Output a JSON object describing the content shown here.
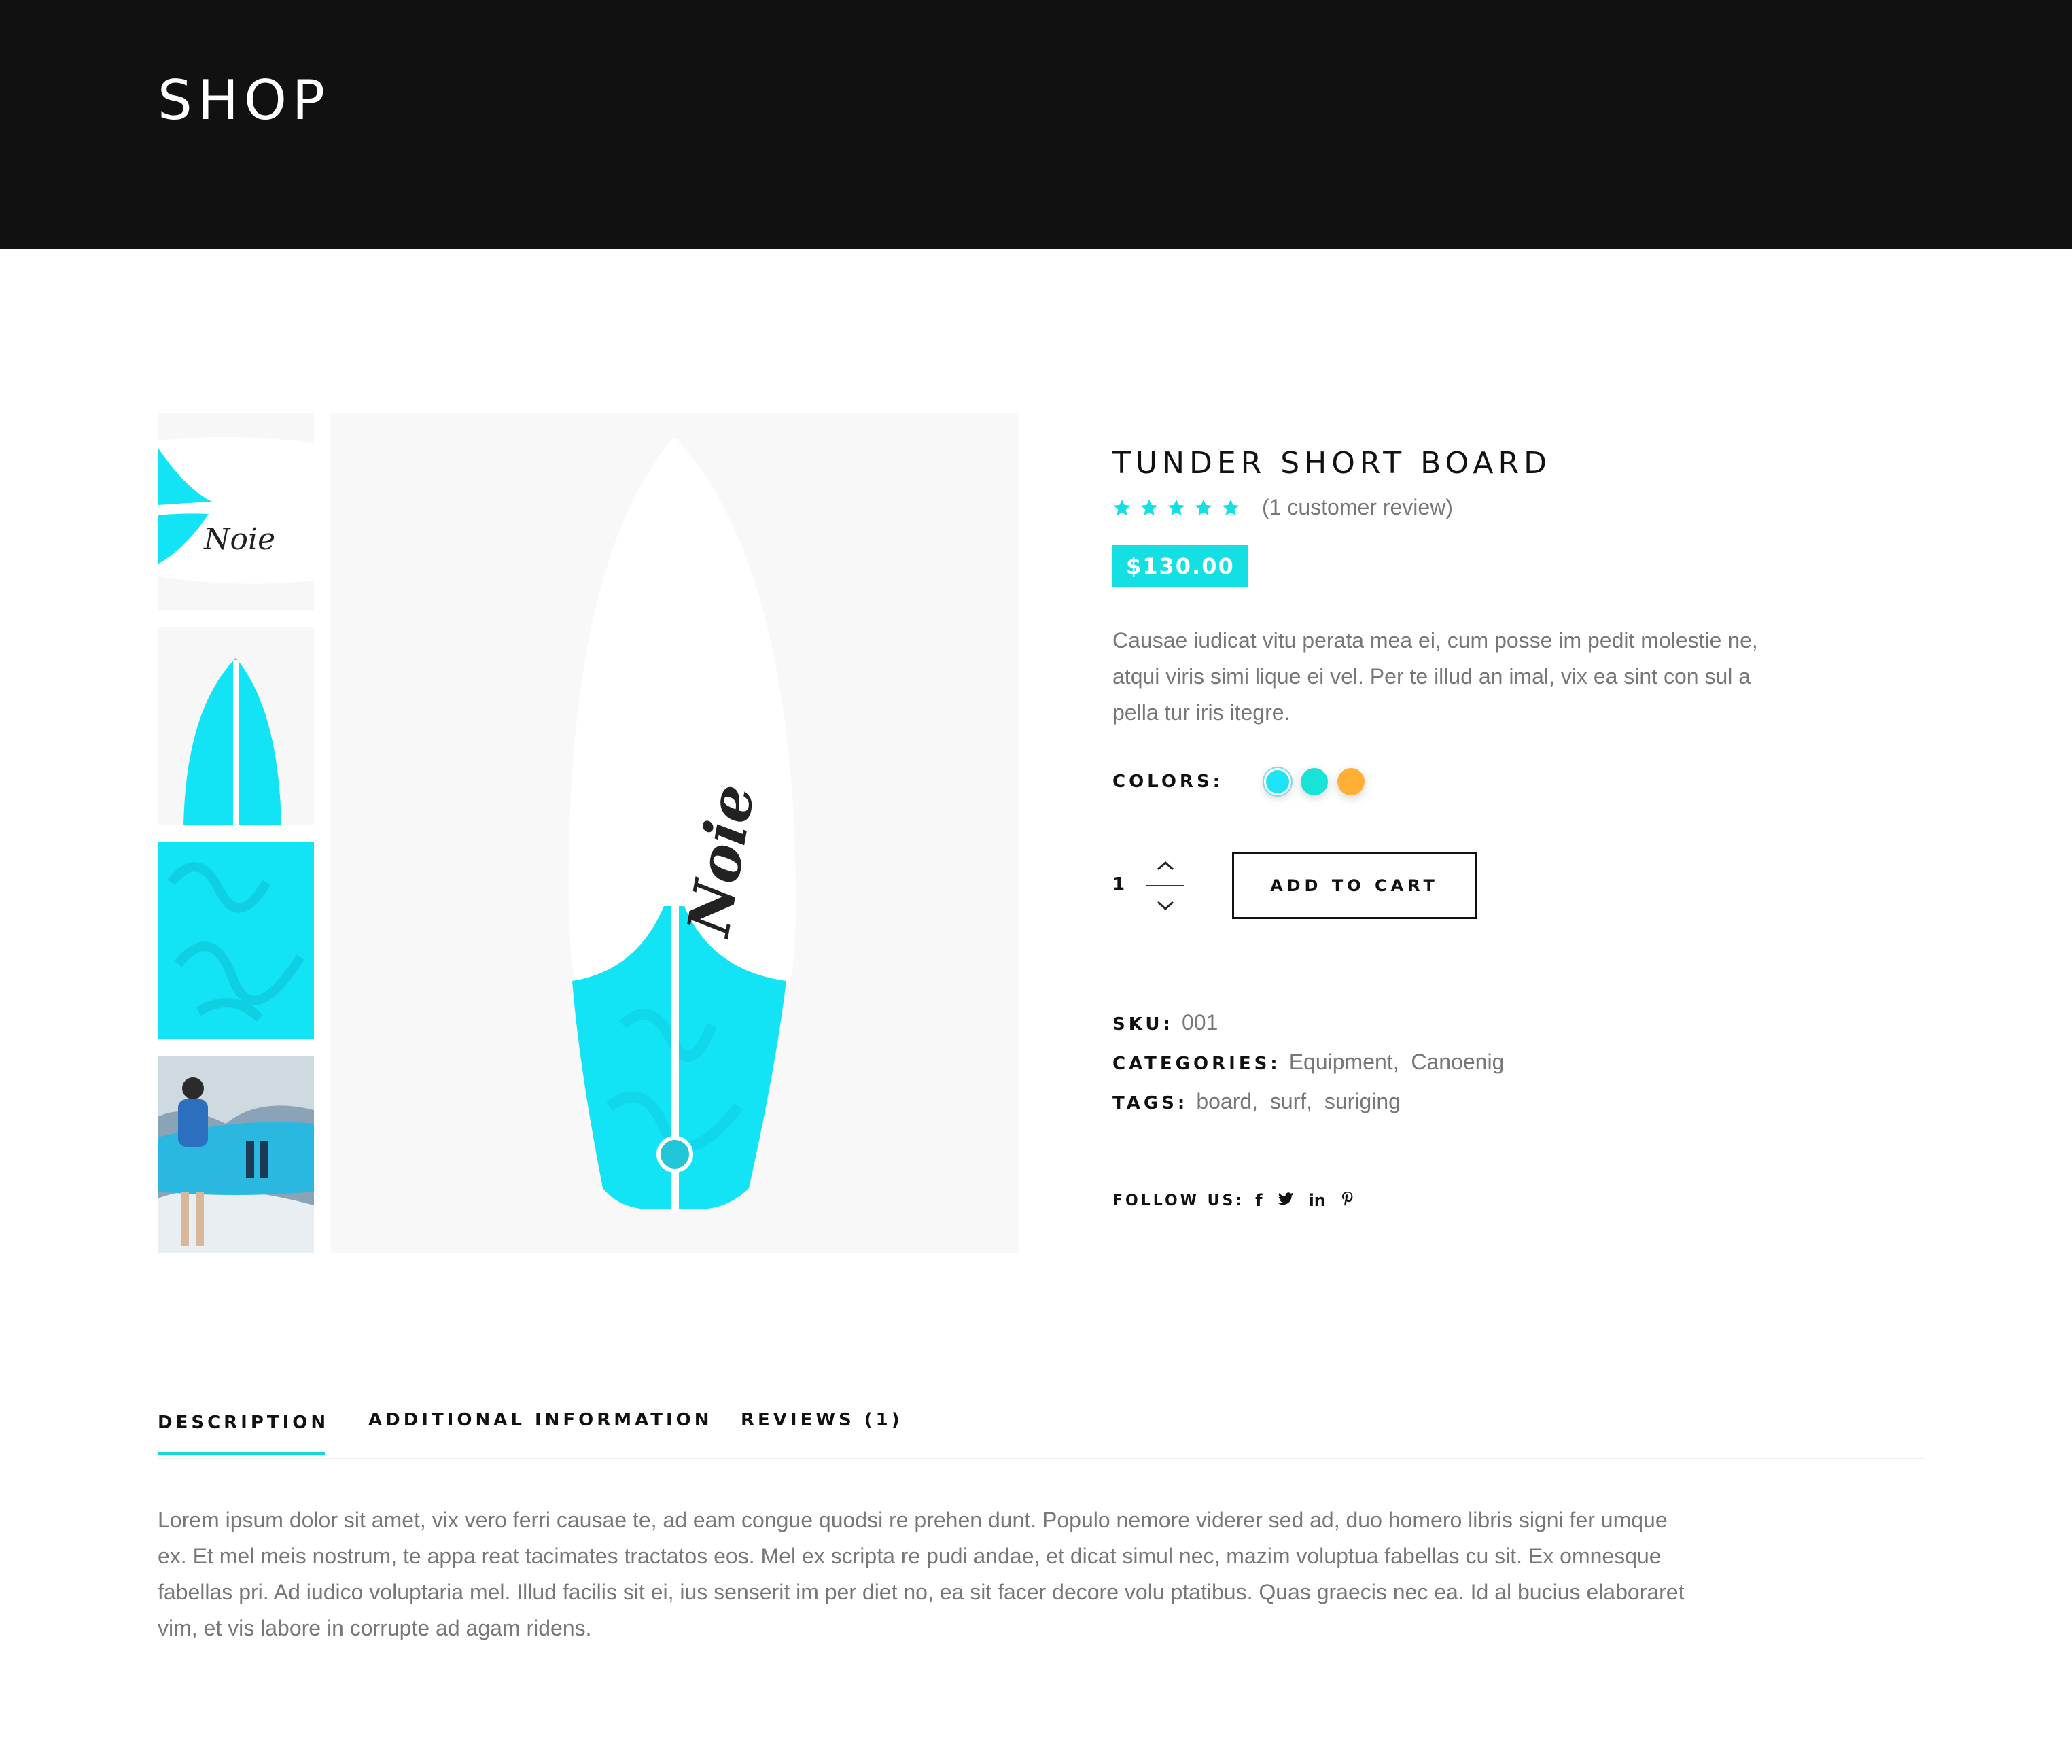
{
  "page": {
    "title": "SHOP"
  },
  "gallery": {
    "thumbnails": [
      {
        "name": "thumb-board-tail-logo"
      },
      {
        "name": "thumb-board-fin"
      },
      {
        "name": "thumb-pattern"
      },
      {
        "name": "thumb-surfer-photo"
      }
    ],
    "logo_text": "Noie"
  },
  "product": {
    "title": "TUNDER SHORT BOARD",
    "rating": 5,
    "rating_max": 5,
    "review_text": "(1 customer review)",
    "price": "$130.00",
    "short_description": "Causae iudicat vitu perata mea ei, cum posse im pedit molestie ne, atqui viris simi lique ei vel. Per te illud an imal, vix ea sint con sul a pella tur iris itegre.",
    "colors_label": "COLORS:",
    "colors": [
      {
        "name": "cyan",
        "hex": "#1ee3f5",
        "selected": true
      },
      {
        "name": "turquoise",
        "hex": "#19e3d6",
        "selected": false
      },
      {
        "name": "orange",
        "hex": "#ffaf36",
        "selected": false
      }
    ],
    "quantity": "1",
    "add_to_cart_label": "ADD TO CART"
  },
  "meta": {
    "sku_label": "SKU:",
    "sku_value": "001",
    "categories_label": "CATEGORIES:",
    "categories": [
      "Equipment",
      "Canoenig"
    ],
    "tags_label": "TAGS:",
    "tags": [
      "board",
      "surf",
      "suriging"
    ]
  },
  "follow": {
    "label": "FOLLOW US:",
    "icons": [
      {
        "name": "facebook-icon",
        "glyph": "f"
      },
      {
        "name": "twitter-icon",
        "glyph": "🐦"
      },
      {
        "name": "linkedin-icon",
        "glyph": "in"
      },
      {
        "name": "pinterest-icon",
        "glyph": "p"
      }
    ]
  },
  "tabs": {
    "items": [
      "DESCRIPTION",
      "ADDITIONAL INFORMATION",
      "REVIEWS (1)"
    ],
    "active": "DESCRIPTION",
    "description": "Lorem ipsum dolor sit amet, vix vero ferri causae te, ad eam congue quodsi re prehen dunt. Populo nemore viderer sed ad, duo homero libris signi fer umque ex. Et mel meis nostrum, te appa reat tacimates tractatos eos. Mel ex scripta re pudi andae, et dicat simul nec, mazim voluptua fabellas cu sit. Ex omnesque fabellas pri. Ad iudico voluptaria mel. Illud facilis sit ei, ius senserit im per diet no, ea sit facer decore volu ptatibus. Quas graecis nec ea. Id al bucius elaboraret vim, et vis labore in corrupte ad agam ridens."
  },
  "colors": {
    "accent": "#14e0e4",
    "header_bg": "#111111",
    "text_muted": "#777777"
  }
}
